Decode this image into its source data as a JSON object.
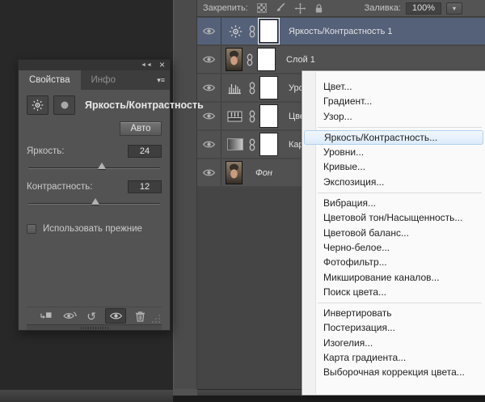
{
  "icons": {
    "dropdown": "▾",
    "collapse": "◄◄",
    "close": "×",
    "panel_menu": "▾≡",
    "reset": "↺"
  },
  "properties_panel": {
    "tabs": [
      {
        "label": "Свойства",
        "active": true
      },
      {
        "label": "Инфо",
        "active": false
      }
    ],
    "header_title": "Яркость/Контрастность",
    "auto_button_label": "Авто",
    "brightness": {
      "label": "Яркость:",
      "value": "24",
      "slider_pct": 56
    },
    "contrast": {
      "label": "Контрастность:",
      "value": "12",
      "slider_pct": 51
    },
    "legacy_checkbox_label": "Использовать прежние",
    "legacy_checkbox_checked": false
  },
  "layers_panel": {
    "lock_label": "Закрепить:",
    "fill_label": "Заливка:",
    "fill_value": "100%",
    "layers": [
      {
        "name": "Яркость/Контрастность 1",
        "type": "brightness-contrast-adjustment",
        "selected": true
      },
      {
        "name": "Слой 1",
        "type": "pixel-layer",
        "selected": false
      },
      {
        "name": "Уро",
        "type": "levels-adjustment",
        "selected": false
      },
      {
        "name": "Цве",
        "type": "color-balance-adjustment",
        "selected": false
      },
      {
        "name": "Кар",
        "type": "gradient-map-adjustment",
        "selected": false
      },
      {
        "name": "Фон",
        "type": "background-layer",
        "selected": false
      }
    ]
  },
  "context_menu": {
    "groups": [
      {
        "items": [
          {
            "label": "Цвет..."
          },
          {
            "label": "Градиент..."
          },
          {
            "label": "Узор..."
          }
        ]
      },
      {
        "items": [
          {
            "label": "Яркость/Контрастность...",
            "highlighted": true
          },
          {
            "label": "Уровни..."
          },
          {
            "label": "Кривые..."
          },
          {
            "label": "Экспозиция..."
          }
        ]
      },
      {
        "items": [
          {
            "label": "Вибрация..."
          },
          {
            "label": "Цветовой тон/Насыщенность..."
          },
          {
            "label": "Цветовой баланс..."
          },
          {
            "label": "Черно-белое..."
          },
          {
            "label": "Фотофильтр..."
          },
          {
            "label": "Микширование каналов..."
          },
          {
            "label": "Поиск цвета..."
          }
        ]
      },
      {
        "items": [
          {
            "label": "Инвертировать"
          },
          {
            "label": "Постеризация..."
          },
          {
            "label": "Изогелия..."
          },
          {
            "label": "Карта градиента..."
          },
          {
            "label": "Выборочная коррекция цвета..."
          }
        ]
      }
    ]
  },
  "colors": {
    "selected_layer_bg": "#556179",
    "menu_highlight_bg": "#dcebfa",
    "menu_highlight_border": "#b0d2ef",
    "panel_bg": "#535353",
    "layers_panel_bg": "#474747",
    "workspace_bg": "#282828"
  }
}
